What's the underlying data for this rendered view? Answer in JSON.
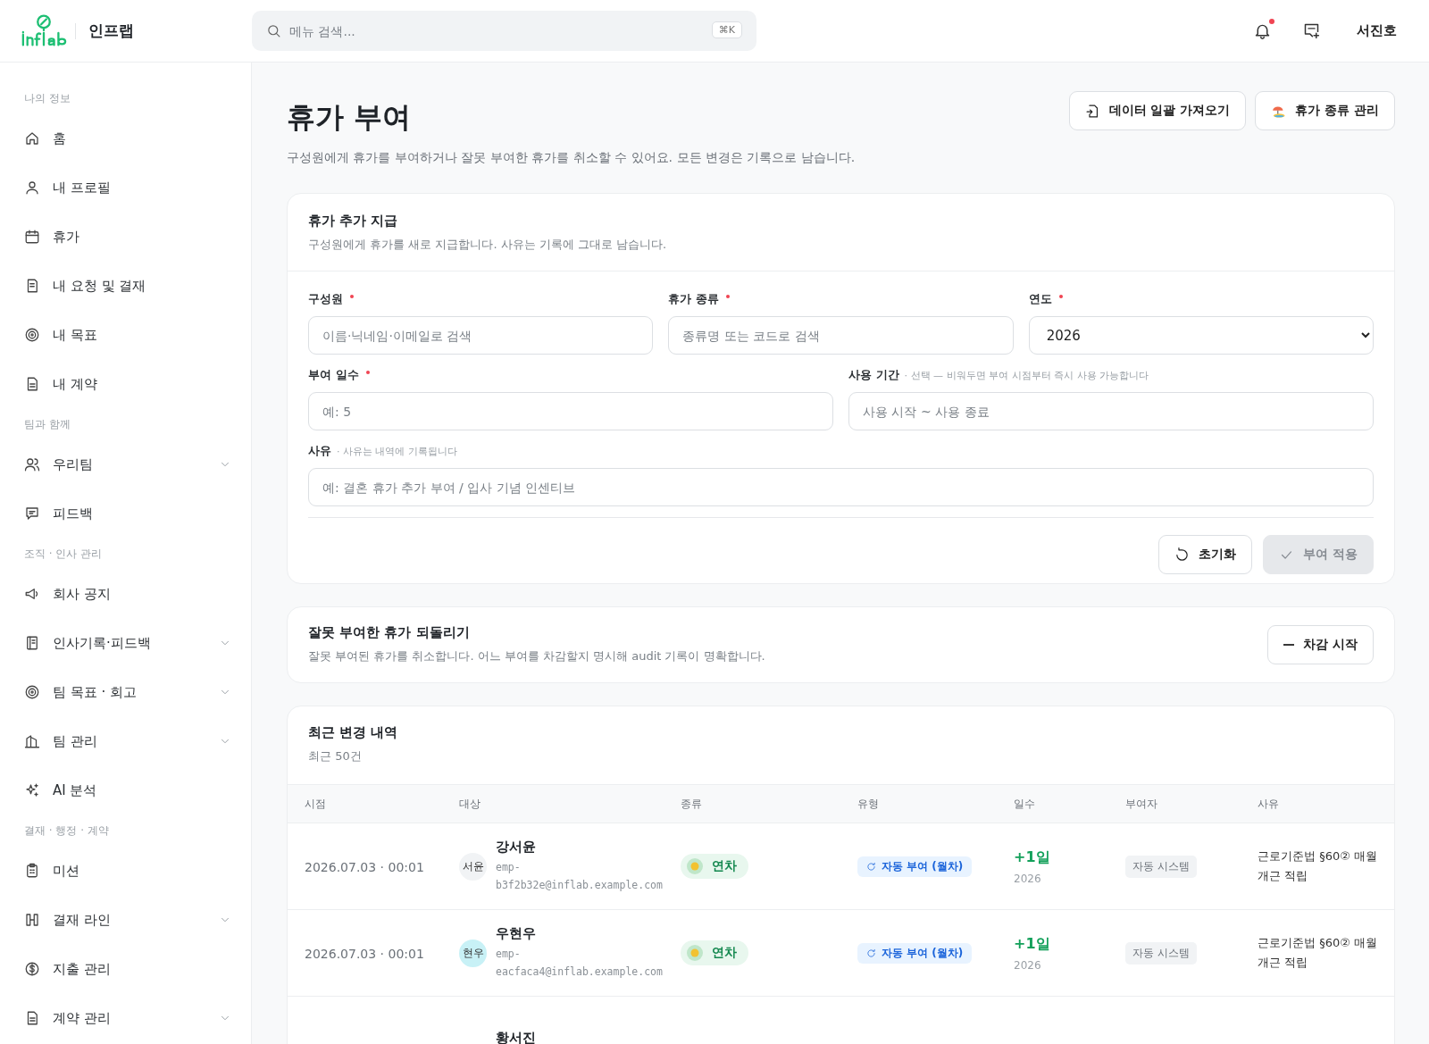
{
  "brand": {
    "name": "인프랩"
  },
  "search": {
    "placeholder": "메뉴 검색...",
    "shortcut": "⌘K"
  },
  "header": {
    "has_notification": true,
    "user": "서진호"
  },
  "sidebar": {
    "sections": [
      {
        "title": "나의 정보",
        "items": [
          {
            "label": "홈",
            "kind": "home",
            "expandable": false
          },
          {
            "label": "내 프로필",
            "kind": "user",
            "expandable": false
          },
          {
            "label": "휴가",
            "kind": "calendar",
            "expandable": false
          },
          {
            "label": "내 요청 및 결재",
            "kind": "doc",
            "expandable": false
          },
          {
            "label": "내 목표",
            "kind": "target",
            "expandable": false
          },
          {
            "label": "내 계약",
            "kind": "file",
            "expandable": false
          }
        ]
      },
      {
        "title": "팀과 함께",
        "items": [
          {
            "label": "우리팀",
            "kind": "users",
            "expandable": true
          },
          {
            "label": "피드백",
            "kind": "chat",
            "expandable": false
          }
        ]
      },
      {
        "title": "조직 · 인사 관리",
        "items": [
          {
            "label": "회사 공지",
            "kind": "megaphone",
            "expandable": false
          },
          {
            "label": "인사기록·피드백",
            "kind": "book",
            "expandable": true
          },
          {
            "label": "팀 목표 · 회고",
            "kind": "target",
            "expandable": true
          },
          {
            "label": "팀 관리",
            "kind": "building",
            "expandable": true
          },
          {
            "label": "AI 분석",
            "kind": "sparkle",
            "expandable": false
          }
        ]
      },
      {
        "title": "결재 · 행정 · 계약",
        "items": [
          {
            "label": "미션",
            "kind": "clipboard",
            "expandable": false
          },
          {
            "label": "결재 라인",
            "kind": "flow",
            "expandable": true
          },
          {
            "label": "지출 관리",
            "kind": "dollar",
            "expandable": false
          },
          {
            "label": "계약 관리",
            "kind": "file",
            "expandable": true
          }
        ]
      }
    ]
  },
  "page": {
    "title": "휴가 부여",
    "description": "구성원에게 휴가를 부여하거나 잘못 부여한 휴가를 취소할 수 있어요. 모든 변경은 기록으로 남습니다.",
    "actions": [
      {
        "label": "데이터 일괄 가져오기",
        "kind": "import"
      },
      {
        "label": "휴가 종류 관리",
        "kind": "beach"
      }
    ]
  },
  "grant_form": {
    "title": "휴가 추가 지급",
    "subtitle": "구성원에게 휴가를 새로 지급합니다. 사유는 기록에 그대로 남습니다.",
    "fields": [
      {
        "label": "구성원",
        "required": true,
        "kind": "input",
        "placeholder": "이름·닉네임·이메일로 검색"
      },
      {
        "label": "휴가 종류",
        "required": true,
        "kind": "input",
        "placeholder": "종류명 또는 코드로 검색"
      },
      {
        "label": "연도",
        "required": true,
        "kind": "select",
        "value": "2026"
      },
      {
        "label": "부여 일수",
        "required": true,
        "kind": "input",
        "placeholder": "예: 5"
      },
      {
        "label": "사용 기간",
        "required": false,
        "hint": "· 선택 — 비워두면 부여 시점부터 즉시 사용 가능합니다",
        "kind": "input",
        "placeholder": "사용 시작 ~ 사용 종료"
      },
      {
        "label": "사유",
        "required": false,
        "hint": "· 사유는 내역에 기록됩니다",
        "kind": "input",
        "placeholder": "예: 결혼 휴가 추가 부여 / 입사 기념 인센티브"
      }
    ],
    "reset_button": {
      "label": "초기화",
      "disabled": false
    },
    "apply_button": {
      "label": "부여 적용",
      "disabled": true
    }
  },
  "revert": {
    "title": "잘못 부여한 휴가 되돌리기",
    "subtitle": "잘못 부여된 휴가를 취소합니다. 어느 부여를 차감할지 명시해 audit 기록이 명확합니다.",
    "button": "차감 시작"
  },
  "history": {
    "title": "최근 변경 내역",
    "subtitle": "최근 50건",
    "columns": [
      "시점",
      "대상",
      "종류",
      "유형",
      "일수",
      "부여자",
      "사유"
    ],
    "rows": [
      {
        "time": "2026.07.03 · 00:01",
        "avatar": {
          "text": "서윤",
          "color": "#f1f3f5"
        },
        "name": "강서윤",
        "email": "emp-b3f2b32e@inflab.example.com",
        "leave_type": "연차",
        "grant_type": "자동 부여 (월차)",
        "days": "+1일",
        "year": "2026",
        "granter": "자동 시스템",
        "reason": "근로기준법 §60② 매월 개근 적립"
      },
      {
        "time": "2026.07.03 · 00:01",
        "avatar": {
          "text": "현우",
          "color": "#c8f1f6"
        },
        "name": "우현우",
        "email": "emp-eacfaca4@inflab.example.com",
        "leave_type": "연차",
        "grant_type": "자동 부여 (월차)",
        "days": "+1일",
        "year": "2026",
        "granter": "자동 시스템",
        "reason": "근로기준법 §60② 매월 개근 적립"
      },
      {
        "name": "황서진"
      }
    ]
  }
}
